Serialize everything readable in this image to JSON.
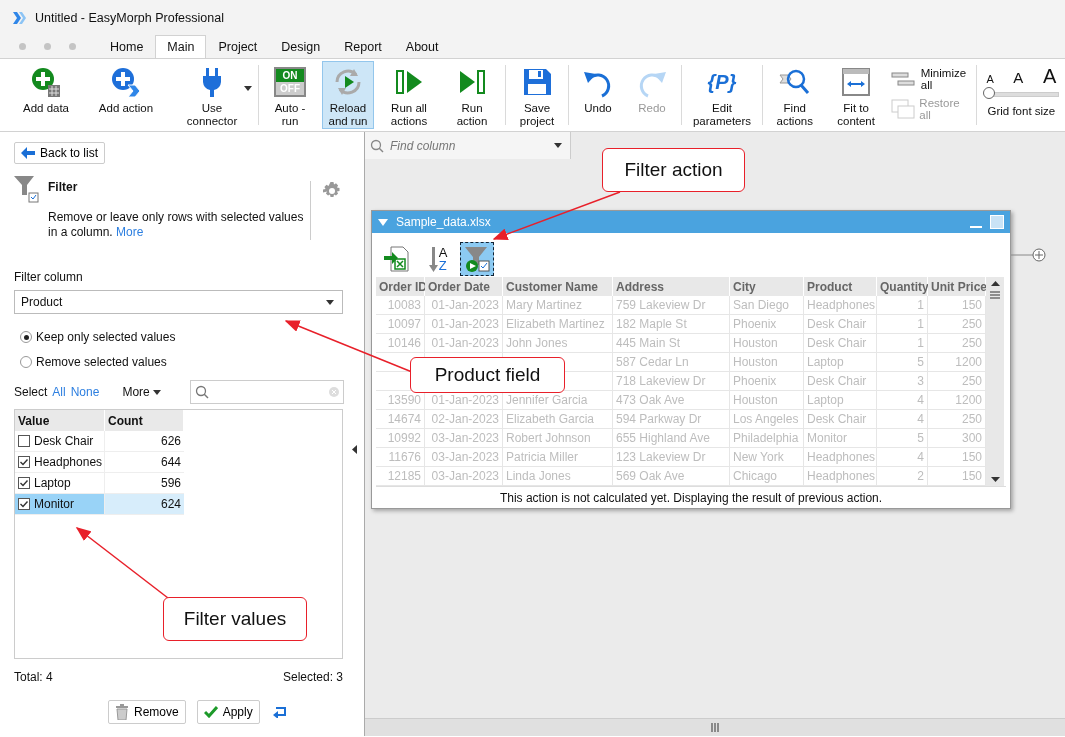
{
  "window": {
    "title": "Untitled - EasyMorph Professional"
  },
  "menu_tabs": [
    {
      "label": "Home",
      "selected": false
    },
    {
      "label": "Main",
      "selected": true
    },
    {
      "label": "Project",
      "selected": false
    },
    {
      "label": "Design",
      "selected": false
    },
    {
      "label": "Report",
      "selected": false
    },
    {
      "label": "About",
      "selected": false
    }
  ],
  "ribbon": [
    [
      {
        "kind": "button",
        "label": "Add data",
        "dropdown": false,
        "pressed": false,
        "disabled": false
      },
      {
        "kind": "button",
        "label": "Add action",
        "dropdown": false,
        "pressed": false,
        "disabled": false
      },
      {
        "kind": "button",
        "label": "Use\nconnector",
        "dropdown": true,
        "pressed": false,
        "disabled": false
      }
    ],
    [
      {
        "kind": "button",
        "label": "Auto -\nrun",
        "switch": [
          "ON",
          "OFF"
        ],
        "dropdown": false,
        "pressed": false,
        "disabled": false
      },
      {
        "kind": "button",
        "label": "Reload\nand run",
        "dropdown": false,
        "pressed": true,
        "disabled": false
      },
      {
        "kind": "button",
        "label": "Run all\nactions",
        "dropdown": false,
        "pressed": false,
        "disabled": false
      },
      {
        "kind": "button",
        "label": "Run\naction",
        "dropdown": false,
        "pressed": false,
        "disabled": false
      }
    ],
    [
      {
        "kind": "button",
        "label": "Save\nproject",
        "dropdown": false,
        "pressed": false,
        "disabled": false
      }
    ],
    [
      {
        "kind": "button",
        "label": "Undo",
        "dropdown": false,
        "pressed": false,
        "disabled": false
      },
      {
        "kind": "button",
        "label": "Redo",
        "dropdown": false,
        "pressed": false,
        "disabled": true
      }
    ],
    [
      {
        "kind": "button",
        "label": "Edit\nparameters",
        "icon_text": "{P}",
        "dropdown": false,
        "pressed": false,
        "disabled": false
      }
    ],
    [
      {
        "kind": "button",
        "label": "Find\nactions",
        "dropdown": false,
        "pressed": false,
        "disabled": false
      },
      {
        "kind": "button",
        "label": "Fit to\ncontent",
        "dropdown": false,
        "pressed": false,
        "disabled": false
      },
      {
        "kind": "pair",
        "items": [
          {
            "label": "Minimize\nall",
            "disabled": false
          },
          {
            "label": "Restore all",
            "disabled": true
          }
        ]
      }
    ],
    [
      {
        "kind": "font-size",
        "sizes": [
          "A",
          "A",
          "A"
        ],
        "level": 0,
        "label": "Grid font size"
      }
    ]
  ],
  "back_button": "Back to list",
  "action": {
    "title": "Filter",
    "description": "Remove or leave only rows with selected values in a column.",
    "more_link": "More"
  },
  "filter_column": {
    "label": "Filter column",
    "value": "Product"
  },
  "modes": [
    {
      "label": "Keep only selected values",
      "selected": true
    },
    {
      "label": "Remove selected values",
      "selected": false
    }
  ],
  "select": {
    "label": "Select",
    "all": "All",
    "none": "None",
    "more": "More"
  },
  "values_table": {
    "columns": [
      "Value",
      "Count"
    ],
    "rows": [
      {
        "value": "Desk Chair",
        "count": "626",
        "checked": false,
        "selected": false
      },
      {
        "value": "Headphones",
        "count": "644",
        "checked": true,
        "selected": false
      },
      {
        "value": "Laptop",
        "count": "596",
        "checked": true,
        "selected": false
      },
      {
        "value": "Monitor",
        "count": "624",
        "checked": true,
        "selected": true
      }
    ]
  },
  "total": "Total: 4",
  "selected_count": "Selected: 3",
  "buttons": {
    "remove": "Remove",
    "apply": "Apply"
  },
  "find_column": {
    "placeholder": "Find column"
  },
  "data_window": {
    "title": "Sample_data.xlsx",
    "steps": [
      {
        "selected": false
      },
      {
        "selected": false,
        "letters": [
          "A",
          "Z"
        ]
      },
      {
        "selected": true
      }
    ],
    "columns": [
      "Order ID",
      "Order Date",
      "Customer Name",
      "Address",
      "City",
      "Product",
      "Quantity",
      "Unit Price"
    ],
    "rows": [
      [
        "10083",
        "01-Jan-2023",
        "Mary Martinez",
        "759 Lakeview Dr",
        "San Diego",
        "Headphones",
        "1",
        "150"
      ],
      [
        "10097",
        "01-Jan-2023",
        "Elizabeth Martinez",
        "182 Maple St",
        "Phoenix",
        "Desk Chair",
        "1",
        "250"
      ],
      [
        "10146",
        "01-Jan-2023",
        "John Jones",
        "445 Main St",
        "Houston",
        "Desk Chair",
        "1",
        "250"
      ],
      [
        null,
        null,
        null,
        "587 Cedar Ln",
        "Houston",
        "Laptop",
        "5",
        "1200"
      ],
      [
        null,
        null,
        null,
        "718 Lakeview Dr",
        "Phoenix",
        "Desk Chair",
        "3",
        "250"
      ],
      [
        "13590",
        "01-Jan-2023",
        "Jennifer Garcia",
        "473 Oak Ave",
        "Houston",
        "Laptop",
        "4",
        "1200"
      ],
      [
        "14674",
        "02-Jan-2023",
        "Elizabeth Garcia",
        "594 Parkway Dr",
        "Los Angeles",
        "Desk Chair",
        "4",
        "250"
      ],
      [
        "10992",
        "03-Jan-2023",
        "Robert Johnson",
        "655 Highland Ave",
        "Philadelphia",
        "Monitor",
        "5",
        "300"
      ],
      [
        "11676",
        "03-Jan-2023",
        "Patricia Miller",
        "123 Lakeview Dr",
        "New York",
        "Headphones",
        "4",
        "150"
      ],
      [
        "12185",
        "03-Jan-2023",
        "Linda Jones",
        "569 Oak Ave",
        "Chicago",
        "Headphones",
        "2",
        "150"
      ]
    ],
    "status": "This action is not calculated yet. Displaying the result of previous action."
  },
  "callouts": [
    {
      "text": "Filter action"
    },
    {
      "text": "Product field"
    },
    {
      "text": "Filter values"
    }
  ]
}
